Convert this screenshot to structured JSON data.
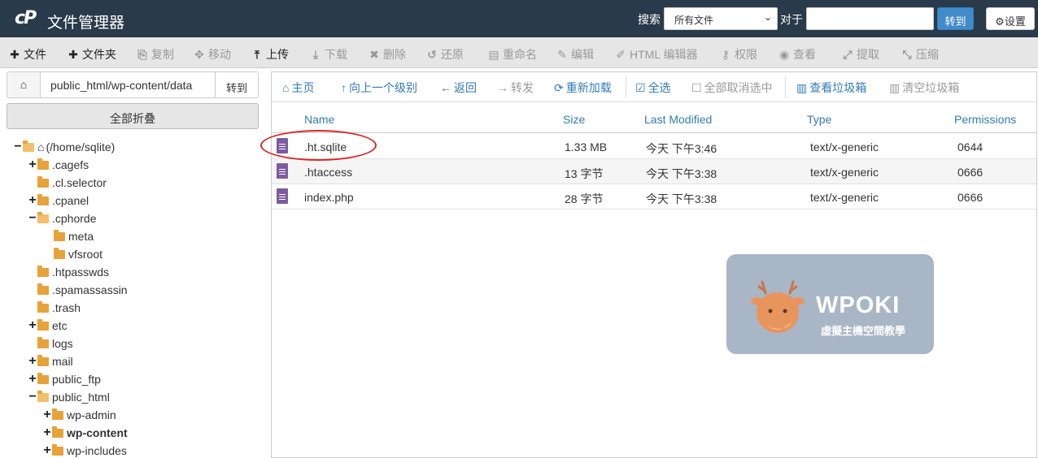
{
  "header": {
    "logo": "cP",
    "title": "文件管理器",
    "search_label": "搜索",
    "search_scope": "所有文件",
    "for_label": "对于",
    "search_value": "",
    "go_label": "转到",
    "settings_label": "设置"
  },
  "toolbar": [
    {
      "label": "文件",
      "icon": "plus-icon",
      "glyph": "✚",
      "enabled": true
    },
    {
      "label": "文件夹",
      "icon": "plus-icon",
      "glyph": "✚",
      "enabled": true
    },
    {
      "label": "复制",
      "icon": "copy-icon",
      "glyph": "⎘",
      "enabled": false
    },
    {
      "label": "移动",
      "icon": "move-icon",
      "glyph": "✥",
      "enabled": false
    },
    {
      "label": "上传",
      "icon": "upload-icon",
      "glyph": "⤒",
      "enabled": true
    },
    {
      "label": "下载",
      "icon": "download-icon",
      "glyph": "⤓",
      "enabled": false
    },
    {
      "label": "删除",
      "icon": "delete-icon",
      "glyph": "✖",
      "enabled": false
    },
    {
      "label": "还原",
      "icon": "restore-icon",
      "glyph": "↺",
      "enabled": false
    },
    {
      "label": "重命名",
      "icon": "rename-icon",
      "glyph": "▤",
      "enabled": false
    },
    {
      "label": "编辑",
      "icon": "pencil-icon",
      "glyph": "✎",
      "enabled": false
    },
    {
      "label": "HTML 编辑器",
      "icon": "html-editor-icon",
      "glyph": "✐",
      "enabled": false
    },
    {
      "label": "权限",
      "icon": "key-icon",
      "glyph": "⚷",
      "enabled": false
    },
    {
      "label": "查看",
      "icon": "eye-icon",
      "glyph": "◉",
      "enabled": false
    },
    {
      "label": "提取",
      "icon": "expand-icon",
      "glyph": "⤢",
      "enabled": false
    },
    {
      "label": "压缩",
      "icon": "compress-icon",
      "glyph": "⤡",
      "enabled": false
    }
  ],
  "pathbar": {
    "path": "public_html/wp-content/data",
    "go_label": "转到"
  },
  "collapse_all": "全部折叠",
  "tree": [
    {
      "label": "(/home/sqlite)",
      "toggle": "−",
      "open": true,
      "home": true
    },
    {
      "label": ".cagefs",
      "toggle": "+",
      "open": false
    },
    {
      "label": ".cl.selector",
      "toggle": "",
      "open": false
    },
    {
      "label": ".cpanel",
      "toggle": "+",
      "open": false
    },
    {
      "label": ".cphorde",
      "toggle": "−",
      "open": true
    },
    {
      "label": "meta",
      "toggle": "",
      "open": false
    },
    {
      "label": "vfsroot",
      "toggle": "",
      "open": false
    },
    {
      "label": ".htpasswds",
      "toggle": "",
      "open": false
    },
    {
      "label": ".spamassassin",
      "toggle": "",
      "open": false
    },
    {
      "label": ".trash",
      "toggle": "",
      "open": false
    },
    {
      "label": "etc",
      "toggle": "+",
      "open": false
    },
    {
      "label": "logs",
      "toggle": "",
      "open": false
    },
    {
      "label": "mail",
      "toggle": "+",
      "open": false
    },
    {
      "label": "public_ftp",
      "toggle": "+",
      "open": false
    },
    {
      "label": "public_html",
      "toggle": "−",
      "open": true
    },
    {
      "label": "wp-admin",
      "toggle": "+",
      "open": false
    },
    {
      "label": "wp-content",
      "toggle": "+",
      "open": false,
      "bold": true
    },
    {
      "label": "wp-includes",
      "toggle": "+",
      "open": false
    }
  ],
  "nav": [
    {
      "label": "主页",
      "icon": "home-icon",
      "glyph": "⌂",
      "enabled": true
    },
    {
      "label": "向上一个级别",
      "icon": "level-up-icon",
      "glyph": "⮥",
      "enabled": true
    },
    {
      "label": "返回",
      "icon": "arrow-left-icon",
      "glyph": "←",
      "enabled": true
    },
    {
      "label": "转发",
      "icon": "arrow-right-icon",
      "glyph": "→",
      "enabled": false
    },
    {
      "label": "重新加载",
      "icon": "reload-icon",
      "glyph": "⟳",
      "enabled": true
    },
    {
      "label": "全选",
      "icon": "checkbox-checked-icon",
      "glyph": "☑",
      "enabled": true
    },
    {
      "label": "全部取消选中",
      "icon": "checkbox-empty-icon",
      "glyph": "☐",
      "enabled": false
    },
    {
      "label": "查看垃圾箱",
      "icon": "trash-icon",
      "glyph": "🗑",
      "enabled": true
    },
    {
      "label": "清空垃圾箱",
      "icon": "trash-empty-icon",
      "glyph": "🗑",
      "enabled": false
    }
  ],
  "table": {
    "columns": [
      "Name",
      "Size",
      "Last Modified",
      "Type",
      "Permissions"
    ],
    "rows": [
      {
        "name": ".ht.sqlite",
        "size": "1.33 MB",
        "modified": "今天 下午3:46",
        "type": "text/x-generic",
        "perms": "0644"
      },
      {
        "name": ".htaccess",
        "size": "13 字节",
        "modified": "今天 下午3:38",
        "type": "text/x-generic",
        "perms": "0666"
      },
      {
        "name": "index.php",
        "size": "28 字节",
        "modified": "今天 下午3:38",
        "type": "text/x-generic",
        "perms": "0666"
      }
    ]
  },
  "watermark": {
    "title": "WPOKI",
    "subtitle": "虛擬主機空間教學"
  },
  "colors": {
    "header_bg": "#293a4a",
    "link": "#337ab7",
    "folder": "#e8a23a",
    "file_icon": "#7b5c9e",
    "highlight_circle": "#d82727"
  }
}
